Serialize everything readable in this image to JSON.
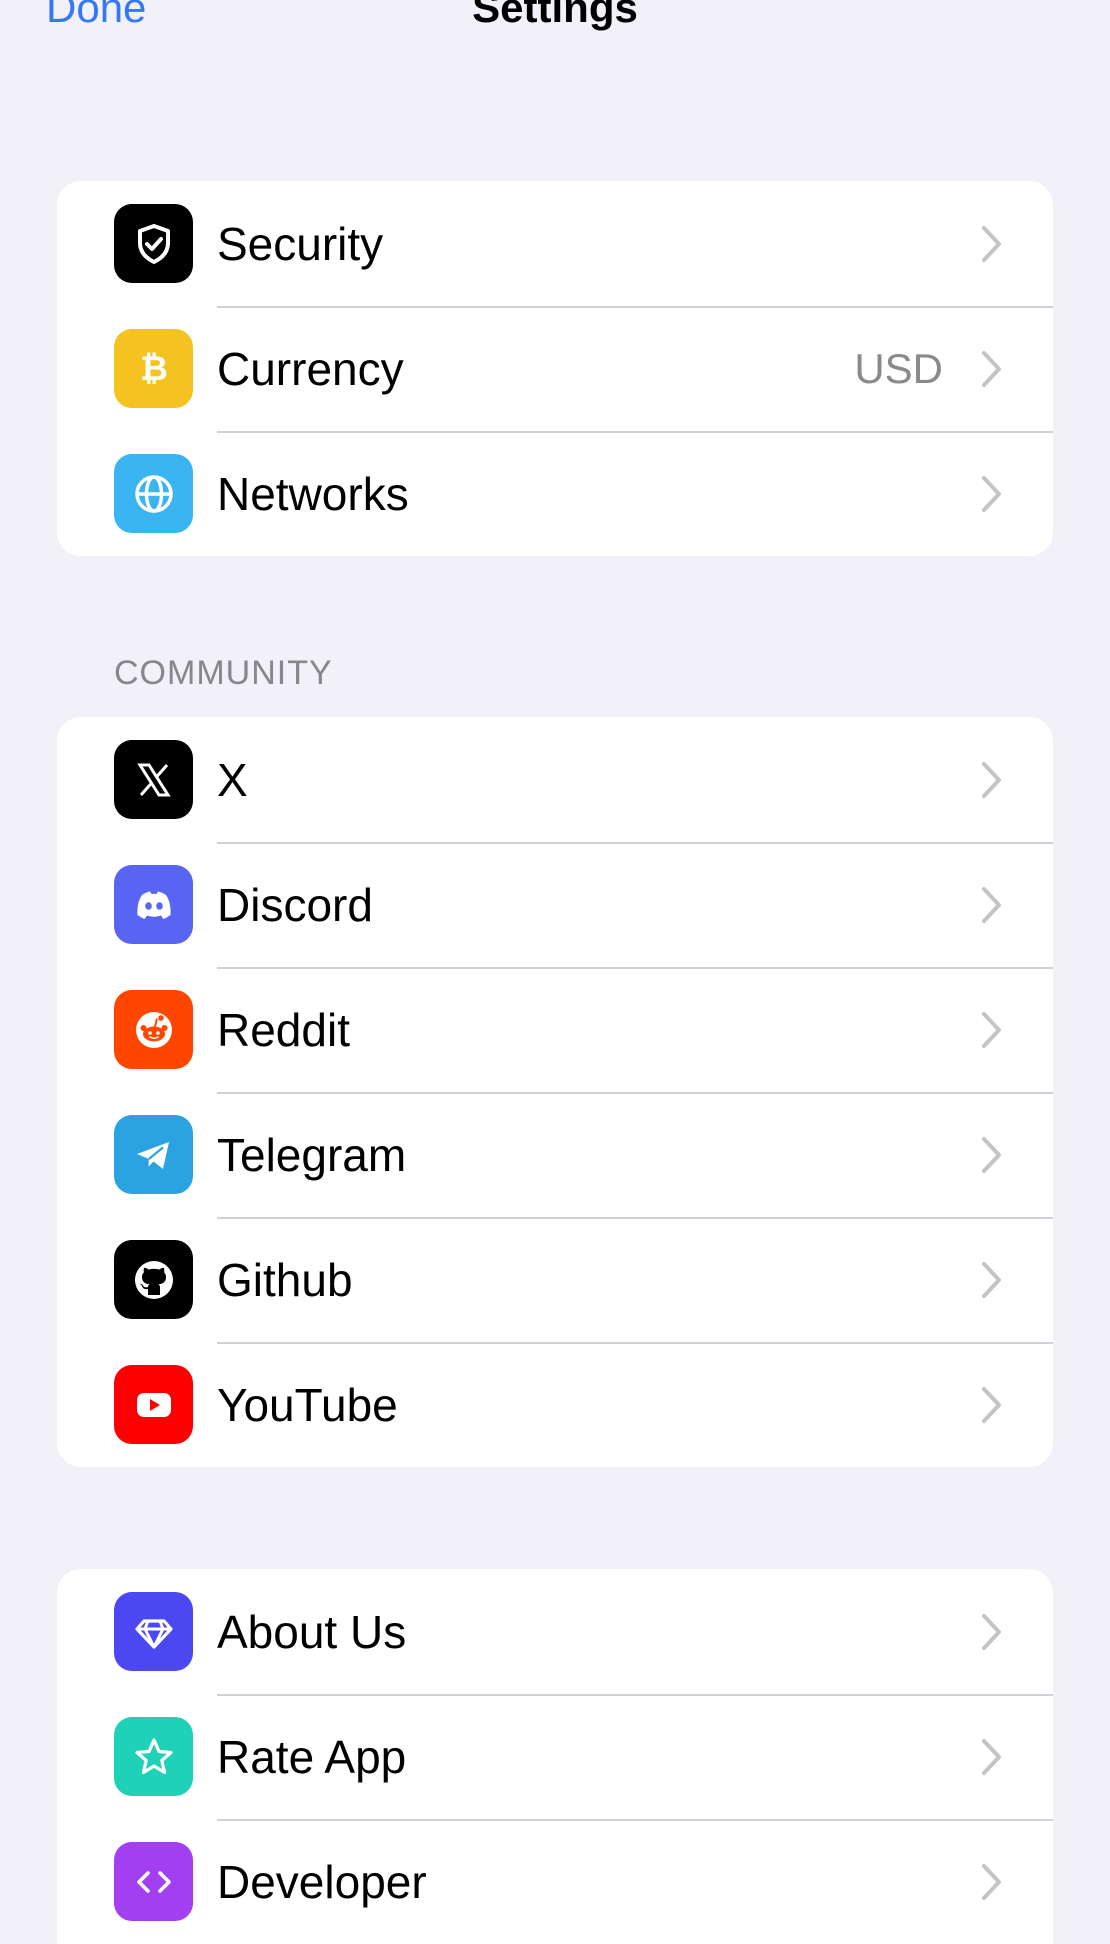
{
  "nav": {
    "done_label": "Done",
    "title": "Settings"
  },
  "groups": [
    {
      "header": "",
      "items": [
        {
          "label": "Security",
          "value": "",
          "icon": "shield-icon",
          "color": "#000000"
        },
        {
          "label": "Currency",
          "value": "USD",
          "icon": "bitcoin-icon",
          "color": "#f4c321"
        },
        {
          "label": "Networks",
          "value": "",
          "icon": "globe-icon",
          "color": "#3bb4f2"
        }
      ]
    },
    {
      "header": "COMMUNITY",
      "items": [
        {
          "label": "X",
          "icon": "x-logo-icon",
          "color": "#000000"
        },
        {
          "label": "Discord",
          "icon": "discord-icon",
          "color": "#5865f2"
        },
        {
          "label": "Reddit",
          "icon": "reddit-icon",
          "color": "#ff4500"
        },
        {
          "label": "Telegram",
          "icon": "telegram-icon",
          "color": "#2aa3e0"
        },
        {
          "label": "Github",
          "icon": "github-icon",
          "color": "#000000"
        },
        {
          "label": "YouTube",
          "icon": "youtube-icon",
          "color": "#ff0000"
        }
      ]
    },
    {
      "header": "",
      "items": [
        {
          "label": "About Us",
          "icon": "diamond-icon",
          "color": "#4b48f2"
        },
        {
          "label": "Rate App",
          "icon": "star-icon",
          "color": "#1fd1b6"
        },
        {
          "label": "Developer",
          "icon": "code-icon",
          "color": "#a23ff0"
        }
      ]
    }
  ]
}
